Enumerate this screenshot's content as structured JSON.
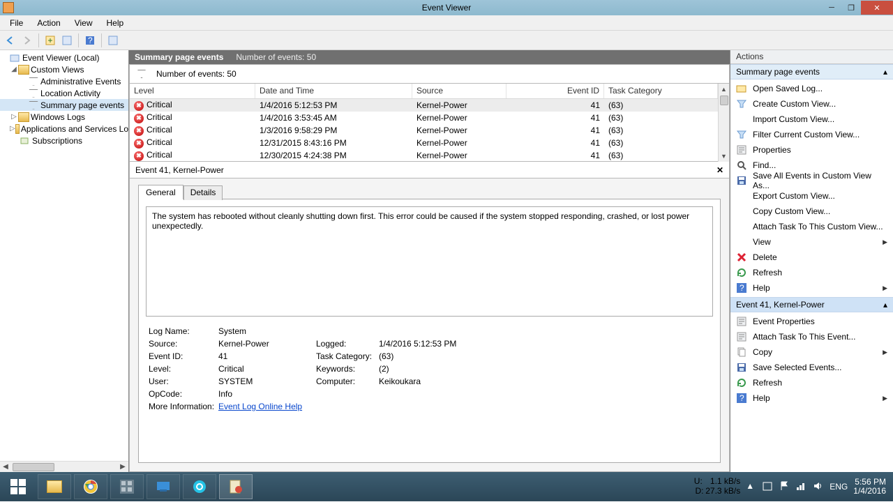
{
  "window": {
    "title": "Event Viewer"
  },
  "menus": [
    "File",
    "Action",
    "View",
    "Help"
  ],
  "tree": {
    "root": "Event Viewer (Local)",
    "customViews": "Custom Views",
    "customChildren": [
      "Administrative Events",
      "Location Activity",
      "Summary page events"
    ],
    "windowsLogs": "Windows Logs",
    "appsServices": "Applications and Services Lo",
    "subscriptions": "Subscriptions"
  },
  "grid": {
    "title": "Summary page events",
    "countLabel": "Number of events: 50",
    "countLabel2": "Number of events: 50",
    "columns": [
      "Level",
      "Date and Time",
      "Source",
      "Event ID",
      "Task Category"
    ],
    "rows": [
      {
        "level": "Critical",
        "date": "1/4/2016 5:12:53 PM",
        "source": "Kernel-Power",
        "id": "41",
        "cat": "(63)",
        "sel": true
      },
      {
        "level": "Critical",
        "date": "1/4/2016 3:53:45 AM",
        "source": "Kernel-Power",
        "id": "41",
        "cat": "(63)"
      },
      {
        "level": "Critical",
        "date": "1/3/2016 9:58:29 PM",
        "source": "Kernel-Power",
        "id": "41",
        "cat": "(63)"
      },
      {
        "level": "Critical",
        "date": "12/31/2015 8:43:16 PM",
        "source": "Kernel-Power",
        "id": "41",
        "cat": "(63)"
      },
      {
        "level": "Critical",
        "date": "12/30/2015 4:24:38 PM",
        "source": "Kernel-Power",
        "id": "41",
        "cat": "(63)"
      }
    ]
  },
  "detail": {
    "header": "Event 41, Kernel-Power",
    "tabs": [
      "General",
      "Details"
    ],
    "description": "The system has rebooted without cleanly shutting down first. This error could be caused if the system stopped responding, crashed, or lost power unexpectedly.",
    "meta": {
      "Log Name:": "System",
      "Source:": "Kernel-Power",
      "Logged:": "1/4/2016 5:12:53 PM",
      "Event ID:": "41",
      "Task Category:": "(63)",
      "Level:": "Critical",
      "Keywords:": "(2)",
      "User:": "SYSTEM",
      "Computer:": "Keikoukara",
      "OpCode:": "Info",
      "More Information:": "",
      "link": "Event Log Online Help"
    }
  },
  "actions": {
    "paneTitle": "Actions",
    "group1": "Summary page events",
    "items1": [
      {
        "icon": "open",
        "label": "Open Saved Log..."
      },
      {
        "icon": "filter",
        "label": "Create Custom View..."
      },
      {
        "icon": "",
        "label": "Import Custom View..."
      },
      {
        "icon": "filter",
        "label": "Filter Current Custom View..."
      },
      {
        "icon": "props",
        "label": "Properties"
      },
      {
        "icon": "find",
        "label": "Find..."
      },
      {
        "icon": "save",
        "label": "Save All Events in Custom View As..."
      },
      {
        "icon": "",
        "label": "Export Custom View..."
      },
      {
        "icon": "",
        "label": "Copy Custom View..."
      },
      {
        "icon": "",
        "label": "Attach Task To This Custom View..."
      },
      {
        "icon": "",
        "label": "View",
        "sub": true
      },
      {
        "icon": "delete",
        "label": "Delete"
      },
      {
        "icon": "refresh",
        "label": "Refresh"
      },
      {
        "icon": "help",
        "label": "Help",
        "sub": true
      }
    ],
    "group2": "Event 41, Kernel-Power",
    "items2": [
      {
        "icon": "props",
        "label": "Event Properties"
      },
      {
        "icon": "props",
        "label": "Attach Task To This Event..."
      },
      {
        "icon": "copy",
        "label": "Copy",
        "sub": true
      },
      {
        "icon": "save",
        "label": "Save Selected Events..."
      },
      {
        "icon": "refresh",
        "label": "Refresh"
      },
      {
        "icon": "help",
        "label": "Help",
        "sub": true
      }
    ]
  },
  "taskbar": {
    "netUp": "U:",
    "netUpV": "1.1 kB/s",
    "netDn": "D:",
    "netDnV": "27.3 kB/s",
    "lang": "ENG",
    "time": "5:56 PM",
    "date": "1/4/2016"
  }
}
